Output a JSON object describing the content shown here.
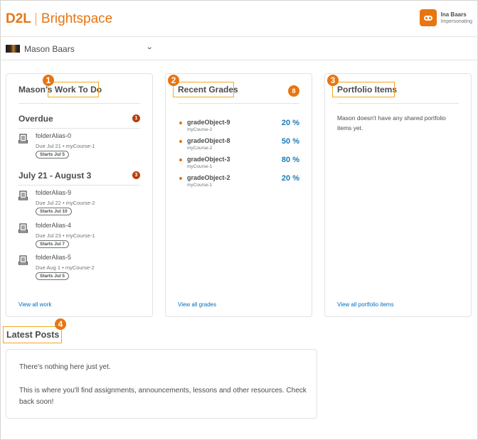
{
  "header": {
    "logo_brand": "D2L",
    "logo_product": "Brightspace",
    "user_name": "Ina Baars",
    "user_status": "Impersonating",
    "avatar_icon": "impersonation-mask-icon"
  },
  "selector": {
    "selected_name": "Mason Baars",
    "chevron_icon": "chevron-down-icon",
    "chevron_glyph": "⌄"
  },
  "callouts": [
    "1",
    "2",
    "3",
    "4"
  ],
  "work_to_do": {
    "title": "Mason's Work To Do",
    "title_prefix": "Mason's",
    "title_suffix": "Work To Do",
    "sections": [
      {
        "heading": "Overdue",
        "count": "1",
        "items": [
          {
            "name": "folderAlias-0",
            "due": "Due Jul 21",
            "course": "myCourse-1",
            "starts": "Starts Jul 5"
          }
        ]
      },
      {
        "heading": "July 21 - August 3",
        "count": "3",
        "items": [
          {
            "name": "folderAlias-9",
            "due": "Due Jul 22",
            "course": "myCourse-2",
            "starts": "Starts Jul 10"
          },
          {
            "name": "folderAlias-4",
            "due": "Due Jul 23",
            "course": "myCourse-1",
            "starts": "Starts Jul 7"
          },
          {
            "name": "folderAlias-5",
            "due": "Due Aug 1",
            "course": "myCourse-2",
            "starts": "Starts Jul 5"
          }
        ]
      }
    ],
    "link": "View all work"
  },
  "recent_grades": {
    "title": "Recent Grades",
    "count": "8",
    "items": [
      {
        "name": "gradeObject-9",
        "course": "myCourse-2",
        "value": "20 %"
      },
      {
        "name": "gradeObject-8",
        "course": "myCourse-2",
        "value": "50 %"
      },
      {
        "name": "gradeObject-3",
        "course": "myCourse-1",
        "value": "80 %"
      },
      {
        "name": "gradeObject-2",
        "course": "myCourse-1",
        "value": "20 %"
      }
    ],
    "link": "View all grades"
  },
  "portfolio": {
    "title": "Portfolio Items",
    "empty_text": "Mason doesn't have any shared portfolio items yet.",
    "link": "View all portfolio items"
  },
  "latest_posts": {
    "title": "Latest Posts",
    "line1": "There's nothing here just yet.",
    "line2": "This is where you'll find assignments, announcements, lessons and other resources. Check back soon!"
  },
  "colors": {
    "brand": "#e87511",
    "highlight": "#f5a623",
    "count_badge": "#b6400f",
    "grade_value": "#1a7bb8",
    "link": "#006fbf"
  }
}
